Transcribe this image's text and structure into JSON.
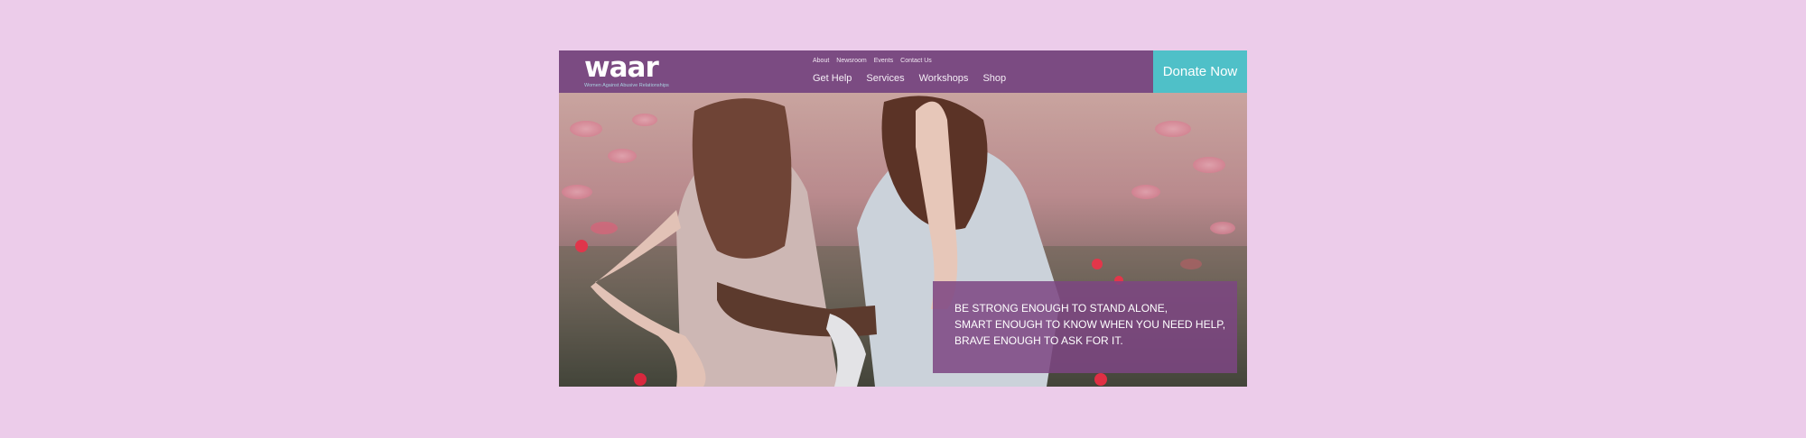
{
  "brand": {
    "logo_text": "waar",
    "tagline": "Women Against Abusive Relationships"
  },
  "top_links": [
    "About",
    "Newsroom",
    "Events",
    "Contact Us"
  ],
  "main_nav": [
    "Get Help",
    "Services",
    "Workshops",
    "Shop"
  ],
  "donate_label": "Donate Now",
  "hero": {
    "quote_lines": [
      "BE STRONG ENOUGH TO STAND ALONE,",
      "SMART ENOUGH TO KNOW WHEN YOU NEED HELP,",
      "BRAVE ENOUGH TO ASK FOR IT."
    ]
  },
  "colors": {
    "page_background": "#ecccea",
    "header": "#7b4b82",
    "donate": "#4fc0c8",
    "quote_box": "#7d4682"
  }
}
